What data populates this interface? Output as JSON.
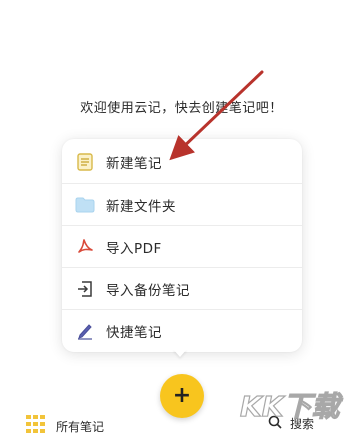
{
  "welcome_text": "欢迎使用云记，快去创建笔记吧！",
  "menu": {
    "items": [
      {
        "label": "新建笔记",
        "icon": "note-icon"
      },
      {
        "label": "新建文件夹",
        "icon": "folder-icon"
      },
      {
        "label": "导入PDF",
        "icon": "pdf-icon"
      },
      {
        "label": "导入备份笔记",
        "icon": "import-icon"
      },
      {
        "label": "快捷笔记",
        "icon": "pen-icon"
      }
    ]
  },
  "fab": {
    "label": "+"
  },
  "bottom_nav": {
    "all_notes_label": "所有笔记",
    "search_label": "搜索"
  },
  "colors": {
    "accent": "#f8c51e",
    "arrow": "#b8332c",
    "note_icon": "#d8b94a",
    "folder_icon": "#a9d3ee",
    "pdf_icon": "#d94a3a",
    "pen_icon": "#4a4f9a"
  },
  "watermark_text": "KK下载"
}
